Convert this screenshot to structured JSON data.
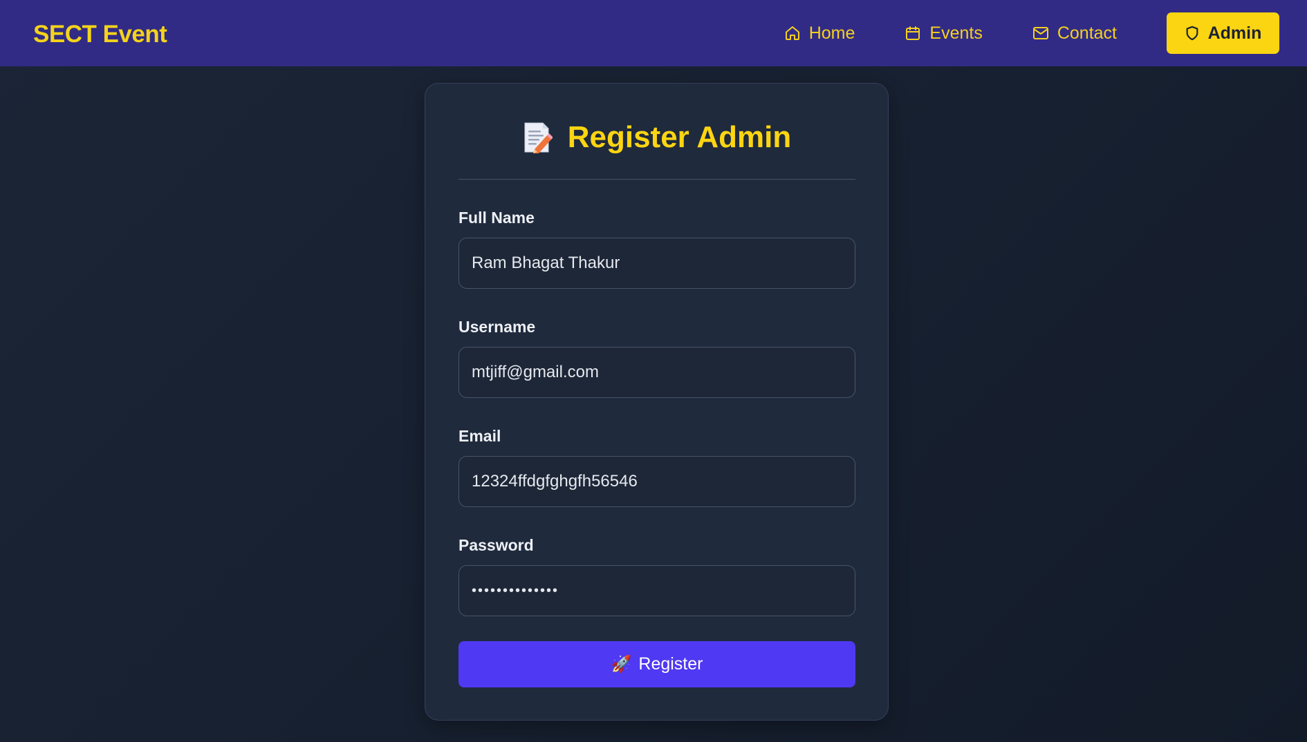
{
  "navbar": {
    "brand": "SECT Event",
    "links": [
      {
        "label": "Home",
        "icon": "home-icon"
      },
      {
        "label": "Events",
        "icon": "calendar-icon"
      },
      {
        "label": "Contact",
        "icon": "mail-icon"
      }
    ],
    "admin_label": "Admin",
    "admin_icon": "shield-icon"
  },
  "form": {
    "title": "Register Admin",
    "title_icon": "memo-icon",
    "fields": {
      "full_name": {
        "label": "Full Name",
        "value": "Ram Bhagat Thakur"
      },
      "username": {
        "label": "Username",
        "value": "mtjiff@gmail.com"
      },
      "email": {
        "label": "Email",
        "value": "12324ffdgfghgfh56546"
      },
      "password": {
        "label": "Password",
        "value": "••••••••••••••"
      }
    },
    "submit_label": "Register",
    "submit_icon": "🚀"
  },
  "colors": {
    "navbar_bg": "#312b86",
    "accent_yellow": "#fcd512",
    "button_purple": "#4f39f2",
    "card_bg": "#1f2a3d",
    "page_bg": "#172030"
  }
}
